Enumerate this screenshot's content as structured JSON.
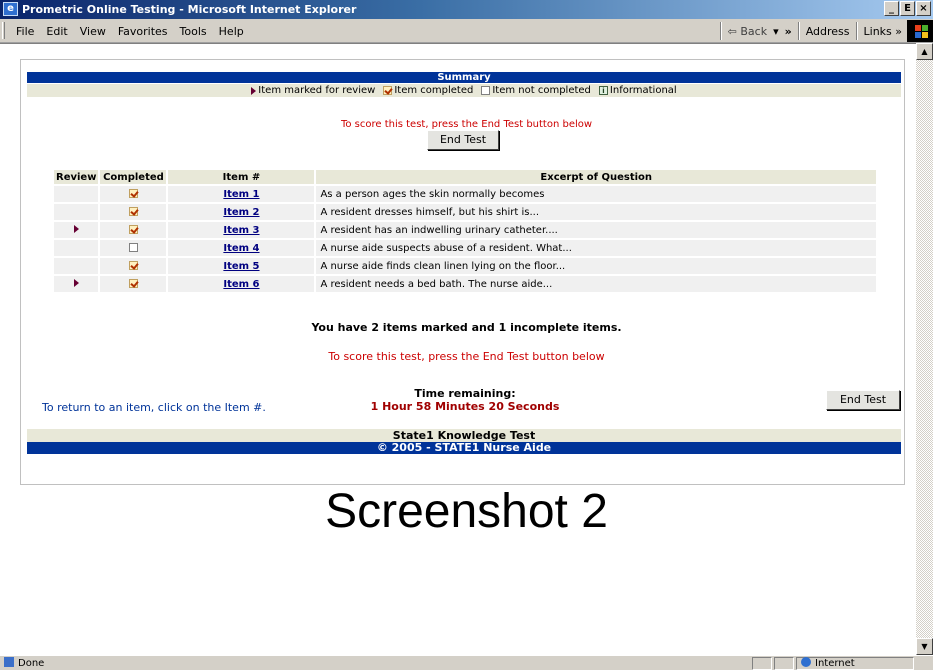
{
  "window": {
    "title": "Prometric Online Testing - Microsoft Internet Explorer",
    "app_icon": "ie-page-icon",
    "controls": [
      "_",
      "Е",
      "×"
    ]
  },
  "menubar": {
    "items": [
      "File",
      "Edit",
      "View",
      "Favorites",
      "Tools",
      "Help"
    ],
    "back_label": "⇦ Back",
    "back_dropdown": "▾",
    "chevron": "»",
    "address_label": "Address",
    "links_label": "Links »"
  },
  "summary": {
    "heading": "Summary",
    "legend": {
      "marked": "Item marked for review",
      "completed": "Item completed",
      "not_completed": "Item not completed",
      "informational": "Informational"
    },
    "score_note_top": "To score this test, press the End Test button below",
    "end_test_label": "End Test",
    "table": {
      "headers": [
        "Review",
        "Completed",
        "Item #",
        "Excerpt of Question"
      ],
      "rows": [
        {
          "review": false,
          "completed": true,
          "item": "Item 1",
          "excerpt": "As a person ages the skin normally becomes"
        },
        {
          "review": false,
          "completed": true,
          "item": "Item 2",
          "excerpt": "A resident dresses himself, but his shirt is..."
        },
        {
          "review": true,
          "completed": true,
          "item": "Item 3",
          "excerpt": "A resident has an indwelling urinary catheter...."
        },
        {
          "review": false,
          "completed": false,
          "item": "Item 4",
          "excerpt": "A nurse aide suspects abuse of a resident. What..."
        },
        {
          "review": false,
          "completed": true,
          "item": "Item 5",
          "excerpt": "A nurse aide finds clean linen lying on the floor..."
        },
        {
          "review": true,
          "completed": true,
          "item": "Item 6",
          "excerpt": "A resident needs a bed bath. The nurse aide..."
        }
      ]
    },
    "status_message": "You have 2 items marked and 1 incomplete items.",
    "score_note_bottom": "To score this test, press the End Test button below",
    "return_note": "To return to an item, click on the Item #.",
    "time_label": "Time remaining:",
    "time_value": "1 Hour 58 Minutes 20 Seconds",
    "footer_title": "State1 Knowledge Test",
    "footer_copyright": "© 2005 - STATE1 Nurse Aide"
  },
  "caption": "Screenshot 2",
  "statusbar": {
    "status": "Done",
    "zone": "Internet"
  },
  "colors": {
    "banner_blue": "#003399",
    "band_tan": "#e8e8d8",
    "alert_red": "#cc0000",
    "review_marker": "#660033"
  }
}
